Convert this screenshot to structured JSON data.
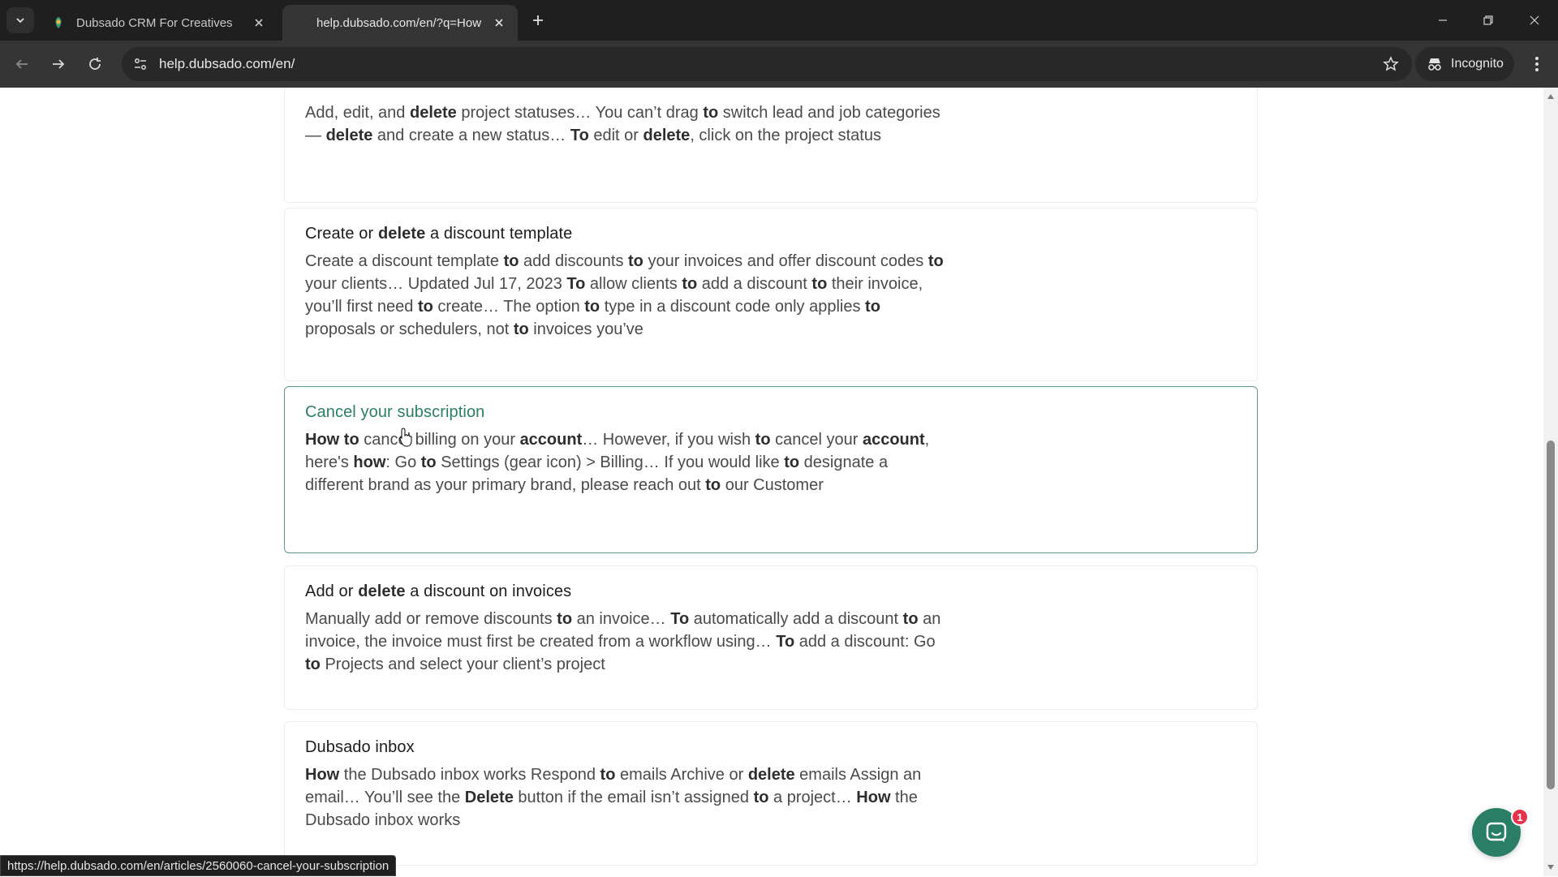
{
  "browser": {
    "tabs": [
      {
        "title": "Dubsado CRM For Creatives",
        "active": false
      },
      {
        "title": "help.dubsado.com/en/?q=How",
        "active": true
      }
    ],
    "url": "help.dubsado.com/en/",
    "incognito_label": "Incognito",
    "status_url": "https://help.dubsado.com/en/articles/2560060-cancel-your-subscription"
  },
  "results": [
    {
      "title_parts": [],
      "snippet_parts": [
        [
          "Add, edit, and ",
          false
        ],
        [
          "delete",
          true
        ],
        [
          " project statuses… You can’t drag ",
          false
        ],
        [
          "to",
          true
        ],
        [
          " switch lead and job categories — ",
          false
        ],
        [
          "delete",
          true
        ],
        [
          " and create a new status… ",
          false
        ],
        [
          "To",
          true
        ],
        [
          " edit or ",
          false
        ],
        [
          "delete",
          true
        ],
        [
          ", click on the project status",
          false
        ]
      ]
    },
    {
      "title_parts": [
        [
          "Create or ",
          false
        ],
        [
          "delete",
          true
        ],
        [
          " a discount template",
          false
        ]
      ],
      "snippet_parts": [
        [
          "Create a discount template ",
          false
        ],
        [
          "to",
          true
        ],
        [
          " add discounts ",
          false
        ],
        [
          "to",
          true
        ],
        [
          " your invoices and offer discount codes ",
          false
        ],
        [
          "to",
          true
        ],
        [
          " your clients… Updated Jul 17, 2023 ",
          false
        ],
        [
          "To",
          true
        ],
        [
          " allow clients ",
          false
        ],
        [
          "to",
          true
        ],
        [
          " add a discount ",
          false
        ],
        [
          "to",
          true
        ],
        [
          " their invoice, you’ll first need ",
          false
        ],
        [
          "to",
          true
        ],
        [
          " create… The option ",
          false
        ],
        [
          "to",
          true
        ],
        [
          " type in a discount code only applies ",
          false
        ],
        [
          "to",
          true
        ],
        [
          " proposals or schedulers, not ",
          false
        ],
        [
          "to",
          true
        ],
        [
          " invoices you’ve",
          false
        ]
      ]
    },
    {
      "title_parts": [
        [
          "Cancel your subscription",
          false
        ]
      ],
      "snippet_parts": [
        [
          "How",
          true
        ],
        [
          " ",
          false
        ],
        [
          "to",
          true
        ],
        [
          " cancel billing on your ",
          false
        ],
        [
          "account",
          true
        ],
        [
          "… However, if you wish ",
          false
        ],
        [
          "to",
          true
        ],
        [
          " cancel your ",
          false
        ],
        [
          "account",
          true
        ],
        [
          ", here's ",
          false
        ],
        [
          "how",
          true
        ],
        [
          ": Go ",
          false
        ],
        [
          "to",
          true
        ],
        [
          " Settings (gear icon) > Billing… If you would like ",
          false
        ],
        [
          "to",
          true
        ],
        [
          " designate a different brand as your primary brand, please reach out ",
          false
        ],
        [
          "to",
          true
        ],
        [
          " our Customer",
          false
        ]
      ]
    },
    {
      "title_parts": [
        [
          "Add or ",
          false
        ],
        [
          "delete",
          true
        ],
        [
          " a discount on invoices",
          false
        ]
      ],
      "snippet_parts": [
        [
          "Manually add or remove discounts ",
          false
        ],
        [
          "to",
          true
        ],
        [
          " an invoice… ",
          false
        ],
        [
          "To",
          true
        ],
        [
          " automatically add a discount ",
          false
        ],
        [
          "to",
          true
        ],
        [
          " an invoice, the invoice must first be created from a workflow using… ",
          false
        ],
        [
          "To",
          true
        ],
        [
          " add a discount: Go ",
          false
        ],
        [
          "to",
          true
        ],
        [
          " Projects and select your client’s project",
          false
        ]
      ]
    },
    {
      "title_parts": [
        [
          "Dubsado inbox",
          false
        ]
      ],
      "snippet_parts": [
        [
          "How",
          true
        ],
        [
          " the Dubsado inbox works Respond ",
          false
        ],
        [
          "to",
          true
        ],
        [
          " emails Archive or ",
          false
        ],
        [
          "delete",
          true
        ],
        [
          " emails Assign an email… You’ll see the ",
          false
        ],
        [
          "Delete",
          true
        ],
        [
          " button if the email isn’t assigned ",
          false
        ],
        [
          "to",
          true
        ],
        [
          " a project… ",
          false
        ],
        [
          "How",
          true
        ],
        [
          " the Dubsado inbox works",
          false
        ]
      ]
    }
  ],
  "chat": {
    "badge_count": "1"
  },
  "colors": {
    "link_hover": "#2b7e66",
    "chat_button": "#2b7e66",
    "badge": "#e5334b"
  }
}
